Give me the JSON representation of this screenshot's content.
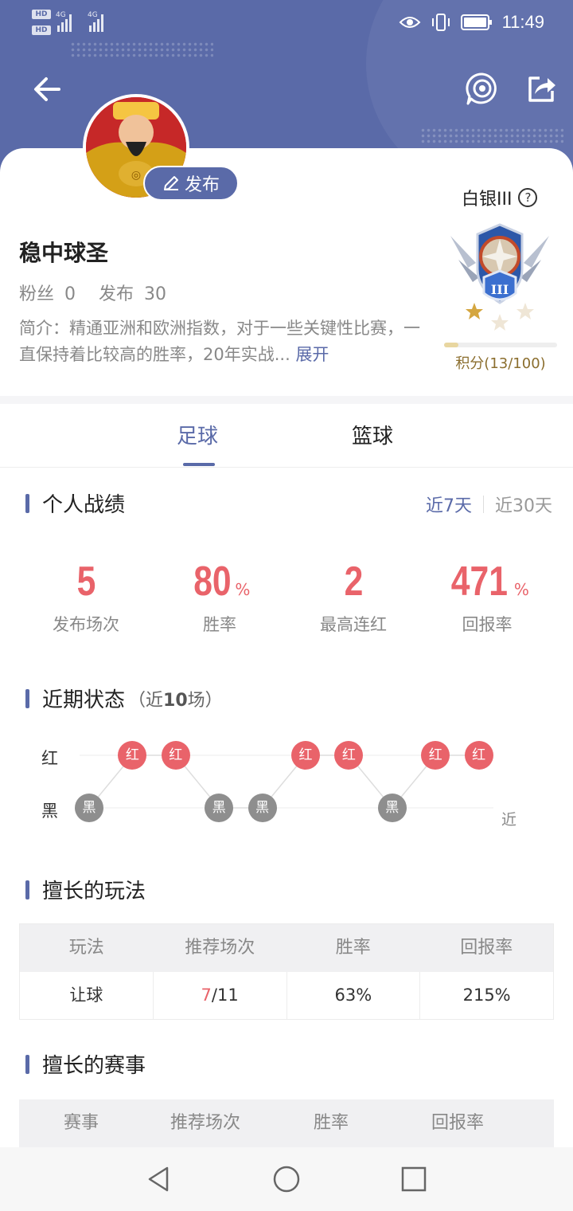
{
  "status_bar": {
    "time": "11:49",
    "hd1": "HD",
    "hd2": "HD",
    "net1": "4G",
    "net2": "4G"
  },
  "header": {
    "back_icon": "arrow-left-icon",
    "live_icon": "live-stream-icon",
    "share_icon": "share-icon"
  },
  "profile": {
    "publish_label": "发布",
    "name": "稳中球圣",
    "fans_label": "粉丝",
    "fans_count": "0",
    "publish_count_label": "发布",
    "publish_count": "30",
    "intro": "简介：精通亚洲和欧洲指数，对于一些关键性比赛，一直保持着比较高的胜率，20年实战...",
    "expand_label": "展开",
    "rank": "白银III",
    "badge_numeral": "III",
    "score_label": "积分(13/100)",
    "score_progress": 0.13
  },
  "tabs": [
    {
      "label": "足球",
      "active": true
    },
    {
      "label": "篮球",
      "active": false
    }
  ],
  "personal": {
    "title": "个人战绩",
    "period_7": "近7天",
    "period_30": "近30天",
    "stats": [
      {
        "value": "5",
        "unit": "",
        "label": "发布场次"
      },
      {
        "value": "80",
        "unit": "%",
        "label": "胜率"
      },
      {
        "value": "2",
        "unit": "",
        "label": "最高连红"
      },
      {
        "value": "471",
        "unit": "%",
        "label": "回报率"
      }
    ]
  },
  "recent": {
    "title": "近期状态",
    "sub_prefix": "（近",
    "sub_count": "10",
    "sub_suffix": "场）",
    "red_label": "红",
    "black_label": "黑",
    "recent_label": "近",
    "results": [
      "黑",
      "红",
      "红",
      "黑",
      "黑",
      "红",
      "红",
      "黑",
      "红",
      "红"
    ]
  },
  "play_types": {
    "title": "擅长的玩法",
    "headers": [
      "玩法",
      "推荐场次",
      "胜率",
      "回报率"
    ],
    "rows": [
      {
        "type": "让球",
        "hits": "7",
        "total": "/11",
        "win_rate": "63%",
        "return_rate": "215%"
      }
    ]
  },
  "events": {
    "title": "擅长的赛事",
    "headers": [
      "赛事",
      "推荐场次",
      "胜率",
      "回报率"
    ]
  },
  "nav": {
    "back": "nav-back-icon",
    "home": "nav-home-icon",
    "recent": "nav-recent-icon"
  }
}
